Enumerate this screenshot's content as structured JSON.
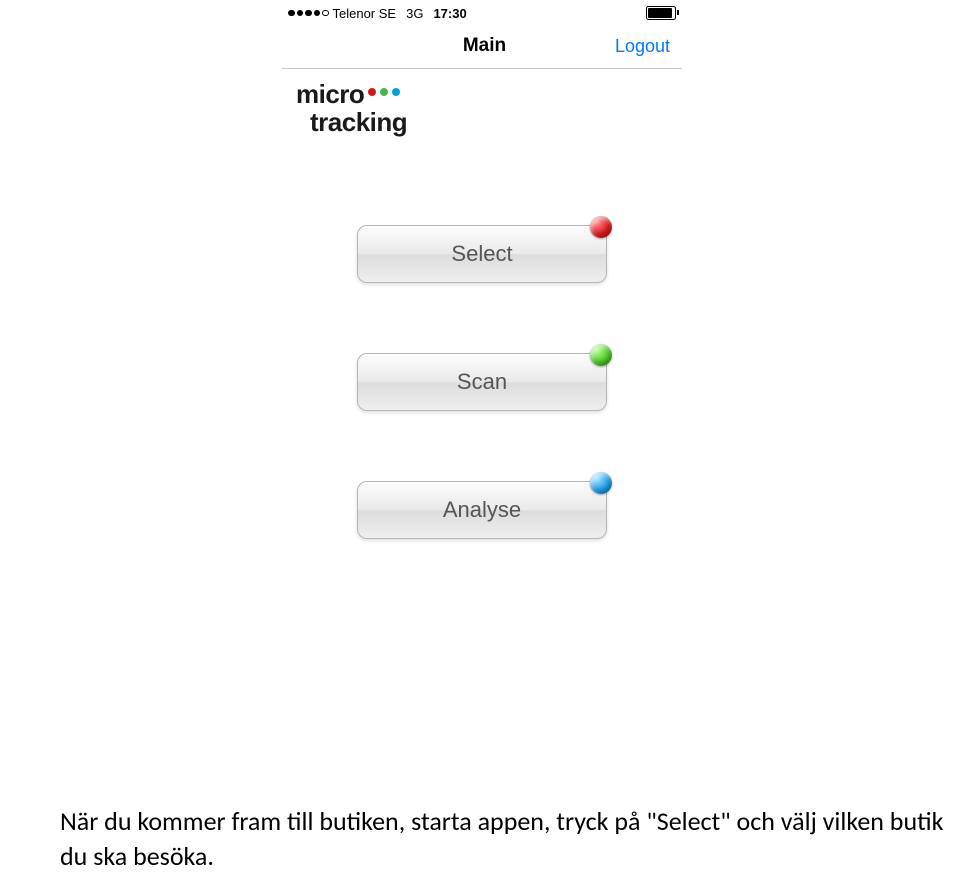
{
  "status": {
    "carrier": "Telenor SE",
    "network": "3G",
    "time": "17:30"
  },
  "nav": {
    "title": "Main",
    "logout": "Logout"
  },
  "logo": {
    "line1": "micro",
    "line2": "tracking"
  },
  "buttons": {
    "select": {
      "label": "Select",
      "dot_color": "red"
    },
    "scan": {
      "label": "Scan",
      "dot_color": "green"
    },
    "analyse": {
      "label": "Analyse",
      "dot_color": "blue"
    }
  },
  "instruction": "När du kommer fram till butiken, starta appen, tryck på \"Select\" och välj vilken butik du ska besöka."
}
